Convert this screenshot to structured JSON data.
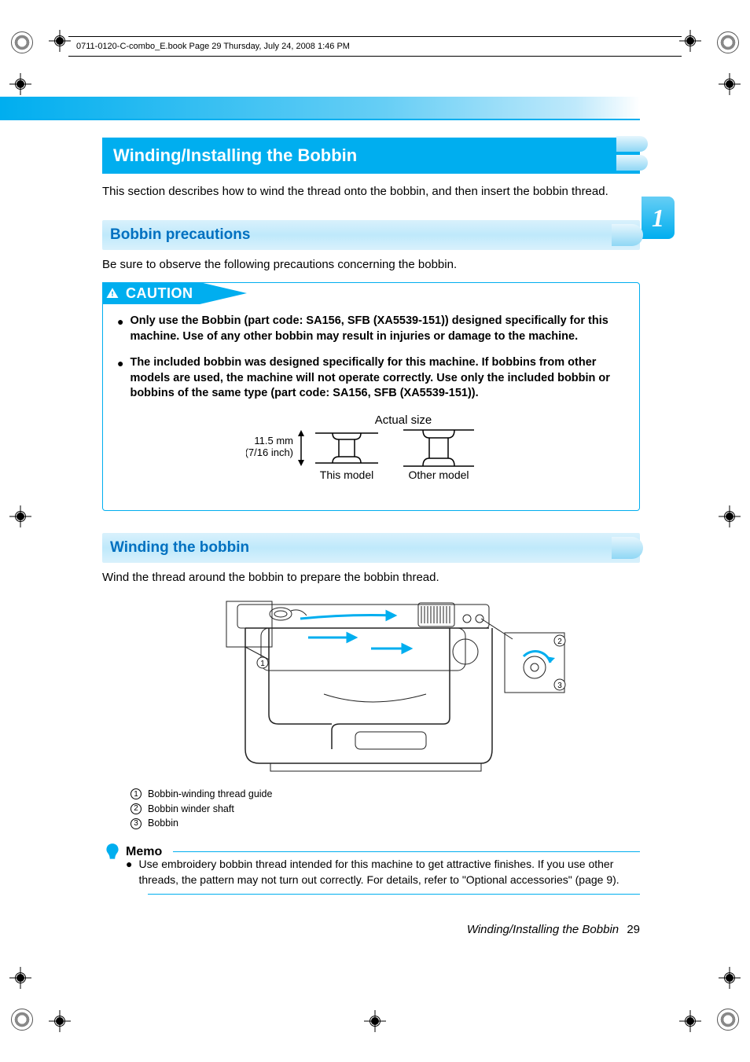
{
  "doc_info": "0711-0120-C-combo_E.book  Page 29  Thursday, July 24, 2008  1:46 PM",
  "chapter": "1",
  "title": "Winding/Installing the Bobbin",
  "intro": "This section describes how to wind the thread onto the bobbin, and then insert the bobbin thread.",
  "section1": {
    "heading": "Bobbin precautions",
    "body": "Be sure to observe the following precautions concerning the bobbin."
  },
  "caution": {
    "label": "CAUTION",
    "items": [
      "Only use the Bobbin (part code: SA156, SFB (XA5539-151)) designed specifically for this machine. Use of any other bobbin may result in injuries or damage to the machine.",
      "The included bobbin was designed specifically for this machine. If bobbins from other models are used, the machine will not operate correctly. Use only the included bobbin or bobbins of the same type (part code: SA156, SFB (XA5539-151))."
    ],
    "diagram": {
      "title": "Actual size",
      "height_mm": "11.5 mm",
      "height_in": "(7/16 inch)",
      "this_model": "This model",
      "other_model": "Other model"
    }
  },
  "section2": {
    "heading": "Winding the bobbin",
    "body": "Wind the thread around the bobbin to prepare the bobbin thread."
  },
  "callouts": [
    "Bobbin-winding thread guide",
    "Bobbin winder shaft",
    "Bobbin"
  ],
  "memo": {
    "label": "Memo",
    "text": "Use embroidery bobbin thread intended for this machine to get attractive finishes. If you use other threads, the pattern may not turn out correctly. For details, refer to \"Optional accessories\" (page 9)."
  },
  "footer": {
    "title": "Winding/Installing the Bobbin",
    "page": "29"
  }
}
